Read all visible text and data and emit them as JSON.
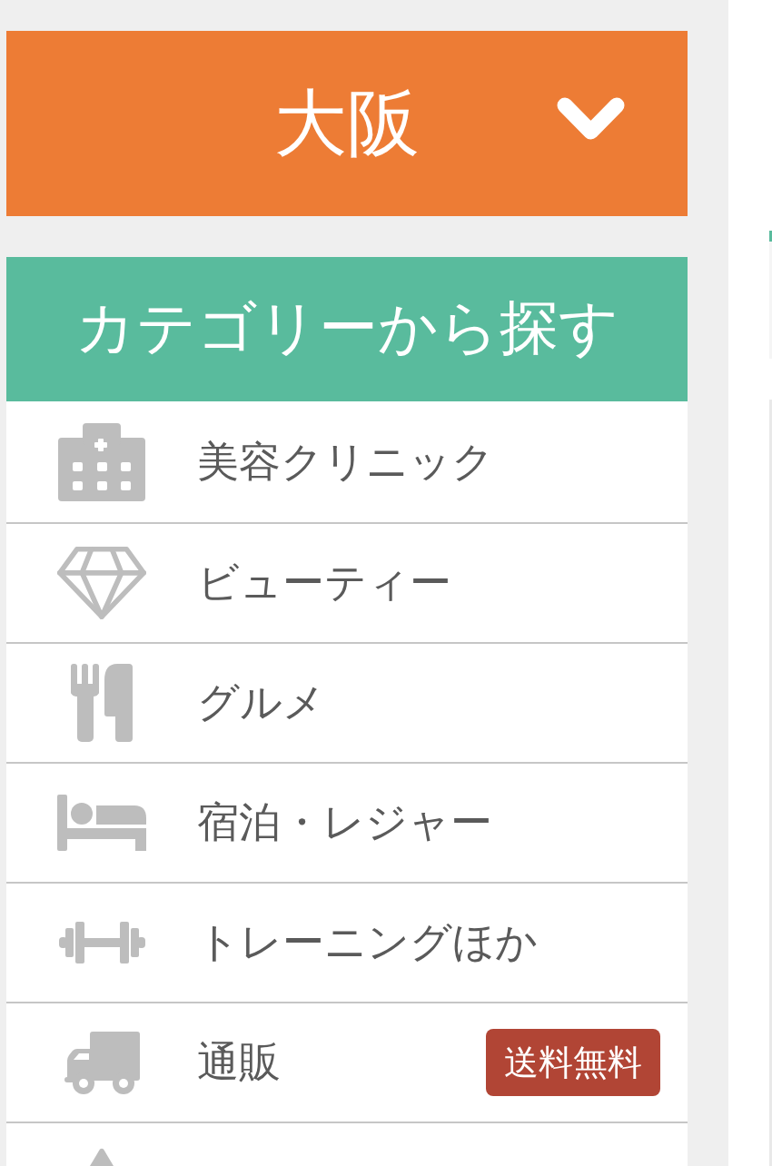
{
  "region_selector": {
    "label": "大阪",
    "expanded": false
  },
  "category_panel": {
    "title": "カテゴリーから探す",
    "items": [
      {
        "kind": "clinic",
        "label": "美容クリニック"
      },
      {
        "kind": "beauty",
        "label": "ビューティー"
      },
      {
        "kind": "gourmet",
        "label": "グルメ"
      },
      {
        "kind": "stay",
        "label": "宿泊・レジャー"
      },
      {
        "kind": "training",
        "label": "トレーニングほか"
      },
      {
        "kind": "mail_order",
        "label": "通販",
        "badge": "送料無料"
      },
      {
        "kind": "triangle"
      }
    ]
  }
}
